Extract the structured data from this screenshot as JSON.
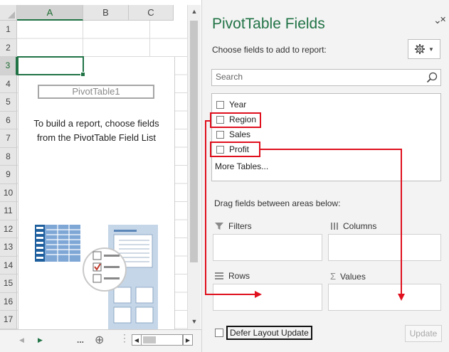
{
  "sheet": {
    "columns": [
      "A",
      "B",
      "C"
    ],
    "selected_column": "A",
    "rows": [
      "1",
      "2",
      "3",
      "4",
      "5",
      "6",
      "7",
      "8",
      "9",
      "10",
      "11",
      "12",
      "13",
      "14",
      "15",
      "16",
      "17"
    ],
    "selected_row": "3",
    "pivot_name": "PivotTable1",
    "pivot_instructions_line1": "To build a report, choose fields",
    "pivot_instructions_line2": "from the PivotTable Field List",
    "tabbar": {
      "ellipsis": "...",
      "add_sheet": "⊕"
    }
  },
  "pane": {
    "title": "PivotTable Fields",
    "subtitle": "Choose fields to add to report:",
    "search_placeholder": "Search",
    "fields": [
      {
        "label": "Year",
        "checked": false
      },
      {
        "label": "Region",
        "checked": false
      },
      {
        "label": "Sales",
        "checked": false
      },
      {
        "label": "Profit",
        "checked": false
      }
    ],
    "more_tables": "More Tables...",
    "drag_label": "Drag fields between areas below:",
    "areas": {
      "filters": "Filters",
      "columns": "Columns",
      "rows": "Rows",
      "values": "Values"
    },
    "defer_label": "Defer Layout Update",
    "update_label": "Update"
  },
  "colors": {
    "excel_green": "#217346",
    "annotation_red": "#e0101e"
  },
  "icons": [
    "gear-icon",
    "chevron-down-icon",
    "search-icon",
    "close-icon",
    "filter-icon",
    "columns-icon",
    "rows-icon",
    "sigma-icon",
    "add-sheet-icon"
  ]
}
